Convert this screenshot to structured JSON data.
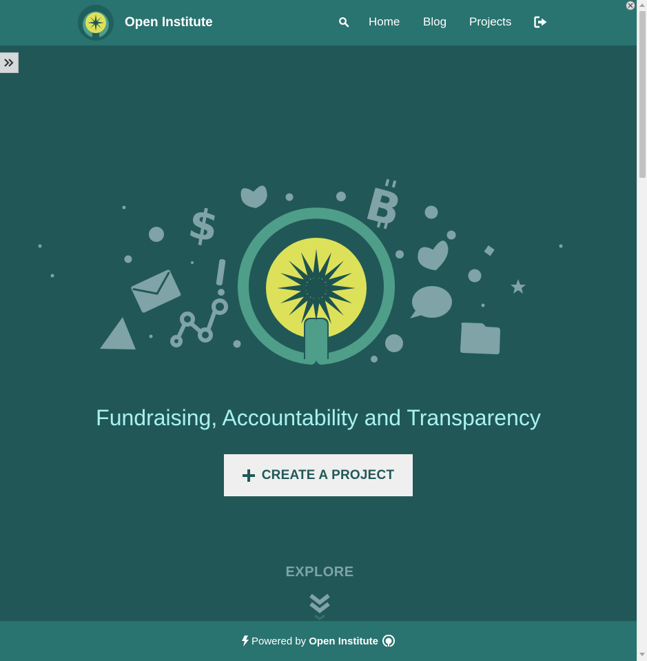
{
  "navbar": {
    "brand_name": "Open Institute",
    "links": {
      "home": "Home",
      "blog": "Blog",
      "projects": "Projects"
    },
    "icons": {
      "search": "search-icon",
      "sign_out": "sign-out-icon"
    }
  },
  "hero": {
    "illustration": "open-institute-illustration",
    "tagline": "Fundraising, Accountability and Transparency",
    "cta_label": "CREATE A PROJECT",
    "explore_label": "EXPLORE"
  },
  "footer": {
    "powered_prefix": "Powered by",
    "powered_brand": "Open Institute"
  },
  "colors": {
    "page_background": "#215857",
    "navbar": "#297370",
    "tagline": "#a9f2ee",
    "logo_yellow": "#dde15a",
    "logo_ring": "#4e9e8a",
    "decor": "#7fa3a6",
    "cta_background": "#efefef"
  }
}
